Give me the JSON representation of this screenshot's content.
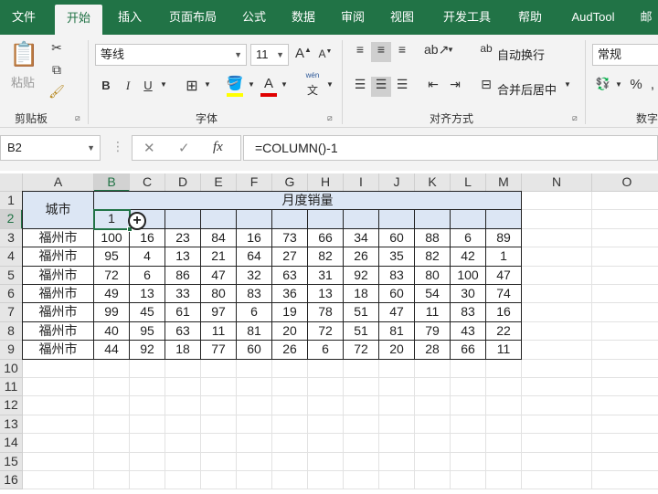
{
  "ribbon_tabs": [
    "文件",
    "开始",
    "插入",
    "页面布局",
    "公式",
    "数据",
    "审阅",
    "视图",
    "开发工具",
    "帮助",
    "AudTool",
    "邮"
  ],
  "active_tab": "开始",
  "clipboard": {
    "paste_label": "粘贴",
    "group_label": "剪贴板"
  },
  "font": {
    "name": "等线",
    "size": "11",
    "group_label": "字体",
    "bold": "B",
    "italic": "I",
    "underline": "U",
    "font_color_glyph": "A",
    "phonetic_glyph": "wén"
  },
  "alignment": {
    "wrap_text": "自动换行",
    "merge_center": "合并后居中",
    "group_label": "对齐方式"
  },
  "number": {
    "format": "常规",
    "percent": "%",
    "group_label": "数字"
  },
  "name_box": "B2",
  "formula_bar": {
    "cancel": "✕",
    "enter": "✓",
    "fx": "fx",
    "formula": "=COLUMN()-1"
  },
  "columns": [
    "A",
    "B",
    "C",
    "D",
    "E",
    "F",
    "G",
    "H",
    "I",
    "J",
    "K",
    "L",
    "M",
    "N",
    "O"
  ],
  "rows": [
    "1",
    "2",
    "3",
    "4",
    "5",
    "6",
    "7",
    "8",
    "9",
    "10",
    "11",
    "12",
    "13",
    "14",
    "15",
    "16"
  ],
  "sheet": {
    "city_header": "城市",
    "month_header": "月度销量",
    "b2_value": "1",
    "data_rows": [
      {
        "city": "福州市",
        "values": [
          "100",
          "16",
          "23",
          "84",
          "16",
          "73",
          "66",
          "34",
          "60",
          "88",
          "6",
          "89"
        ]
      },
      {
        "city": "福州市",
        "values": [
          "95",
          "4",
          "13",
          "21",
          "64",
          "27",
          "82",
          "26",
          "35",
          "82",
          "42",
          "1"
        ]
      },
      {
        "city": "福州市",
        "values": [
          "72",
          "6",
          "86",
          "47",
          "32",
          "63",
          "31",
          "92",
          "83",
          "80",
          "100",
          "47"
        ]
      },
      {
        "city": "福州市",
        "values": [
          "49",
          "13",
          "33",
          "80",
          "83",
          "36",
          "13",
          "18",
          "60",
          "54",
          "30",
          "74"
        ]
      },
      {
        "city": "福州市",
        "values": [
          "99",
          "45",
          "61",
          "97",
          "6",
          "19",
          "78",
          "51",
          "47",
          "11",
          "83",
          "16"
        ]
      },
      {
        "city": "福州市",
        "values": [
          "40",
          "95",
          "63",
          "11",
          "81",
          "20",
          "72",
          "51",
          "81",
          "79",
          "43",
          "22"
        ]
      },
      {
        "city": "福州市",
        "values": [
          "44",
          "92",
          "18",
          "77",
          "60",
          "26",
          "6",
          "72",
          "20",
          "28",
          "66",
          "11"
        ]
      }
    ]
  },
  "colors": {
    "excel_green": "#217346",
    "header_fill": "#dce6f4"
  }
}
